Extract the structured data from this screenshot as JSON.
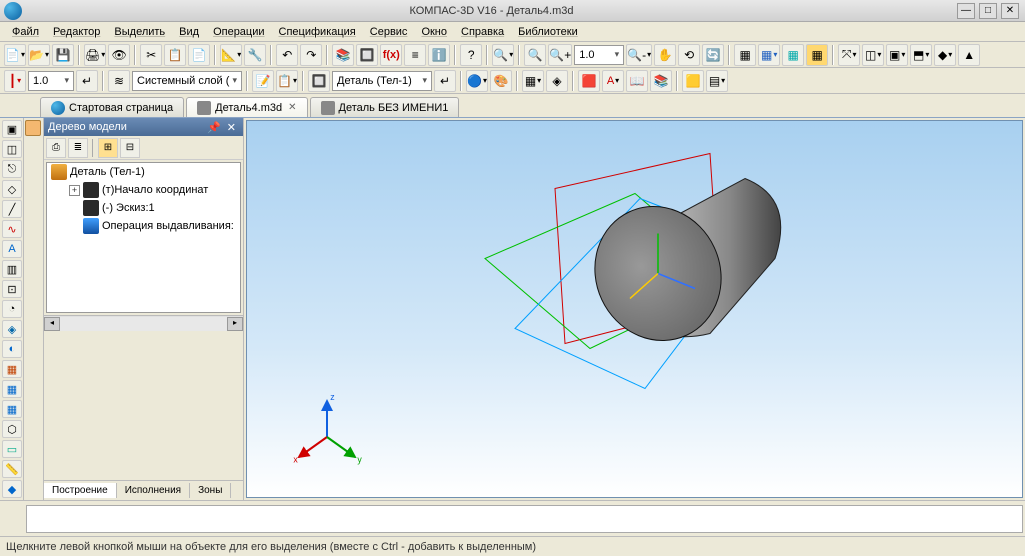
{
  "title": "КОМПАС-3D V16  -  Деталь4.m3d",
  "menus": [
    "Файл",
    "Редактор",
    "Выделить",
    "Вид",
    "Операции",
    "Спецификация",
    "Сервис",
    "Окно",
    "Справка",
    "Библиотеки"
  ],
  "toolbar1": {
    "zoom_value": "1.0"
  },
  "toolbar2": {
    "scale": "1.0",
    "layer": "Системный слой ( ",
    "part": "Деталь (Тел-1)"
  },
  "tabs": [
    {
      "label": "Стартовая страница",
      "active": false,
      "closable": false,
      "tint": "#1fa5e8"
    },
    {
      "label": "Деталь4.m3d",
      "active": true,
      "closable": true,
      "tint": "#888"
    },
    {
      "label": "Деталь БЕЗ ИМЕНИ1",
      "active": false,
      "closable": false,
      "tint": "#888"
    }
  ],
  "tree": {
    "panel_title": "Дерево модели",
    "root": "Деталь (Тел-1)",
    "node_origin": "(т)Начало координат",
    "node_sketch": "(-) Эскиз:1",
    "node_extrude": "Операция выдавливания:",
    "tabs": [
      "Построение",
      "Исполнения",
      "Зоны"
    ]
  },
  "gizmo": {
    "x": "x",
    "y": "y",
    "z": "z"
  },
  "statusbar": "Щелкните левой кнопкой мыши на объекте для его выделения (вместе с Ctrl - добавить к выделенным)"
}
